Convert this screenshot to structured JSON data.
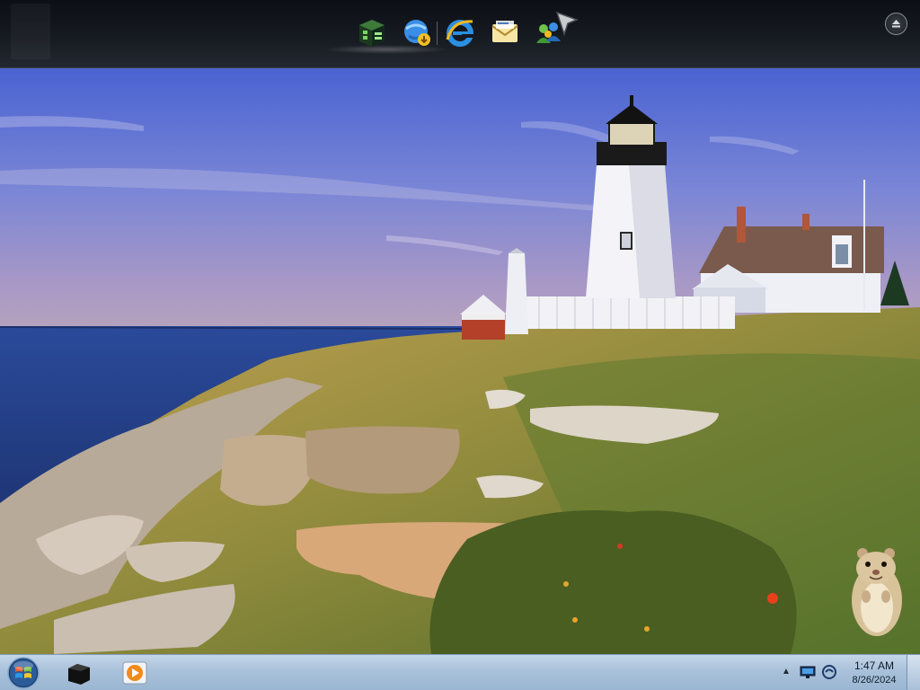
{
  "dock": {
    "icons": [
      "app-cube-icon",
      "ie-download-icon",
      "internet-explorer-icon",
      "mail-envelope-icon",
      "messenger-people-icon"
    ]
  },
  "taskbar": {
    "pinned": [
      "start-orb-icon",
      "black-box-icon",
      "media-player-icon"
    ]
  },
  "tray": {
    "chevron": "▲",
    "time": "1:47 AM",
    "date": "8/26/2024"
  },
  "colors": {
    "dock_top": "#0c0f15",
    "taskbar": "#a9c1da",
    "sky": "#5a73d8",
    "sea": "#2c4a96",
    "grass": "#9a8a3a"
  }
}
